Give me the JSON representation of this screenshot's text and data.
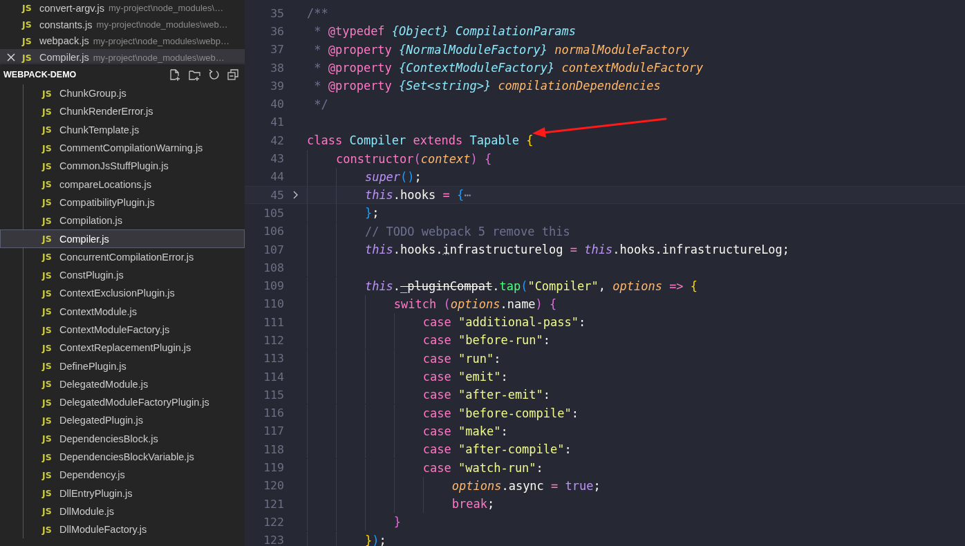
{
  "open_editors": [
    {
      "name": "convert-argv.js",
      "path": "my-project\\node_modules\\…",
      "icon": "JS",
      "selected": false
    },
    {
      "name": "constants.js",
      "path": "my-project\\node_modules\\web…",
      "icon": "JS",
      "selected": false
    },
    {
      "name": "webpack.js",
      "path": "my-project\\node_modules\\webp…",
      "icon": "JS",
      "selected": false
    },
    {
      "name": "Compiler.js",
      "path": "my-project\\node_modules\\web…",
      "icon": "JS",
      "selected": true
    }
  ],
  "explorer": {
    "title": "WEBPACK-DEMO",
    "actions": [
      {
        "kind": "new-file"
      },
      {
        "kind": "new-folder"
      },
      {
        "kind": "refresh"
      },
      {
        "kind": "collapse"
      }
    ],
    "files": [
      {
        "name": "ChunkGroup.js",
        "icon": "JS",
        "selected": false
      },
      {
        "name": "ChunkRenderError.js",
        "icon": "JS",
        "selected": false
      },
      {
        "name": "ChunkTemplate.js",
        "icon": "JS",
        "selected": false
      },
      {
        "name": "CommentCompilationWarning.js",
        "icon": "JS",
        "selected": false
      },
      {
        "name": "CommonJsStuffPlugin.js",
        "icon": "JS",
        "selected": false
      },
      {
        "name": "compareLocations.js",
        "icon": "JS",
        "selected": false
      },
      {
        "name": "CompatibilityPlugin.js",
        "icon": "JS",
        "selected": false
      },
      {
        "name": "Compilation.js",
        "icon": "JS",
        "selected": false
      },
      {
        "name": "Compiler.js",
        "icon": "JS",
        "selected": true
      },
      {
        "name": "ConcurrentCompilationError.js",
        "icon": "JS",
        "selected": false
      },
      {
        "name": "ConstPlugin.js",
        "icon": "JS",
        "selected": false
      },
      {
        "name": "ContextExclusionPlugin.js",
        "icon": "JS",
        "selected": false
      },
      {
        "name": "ContextModule.js",
        "icon": "JS",
        "selected": false
      },
      {
        "name": "ContextModuleFactory.js",
        "icon": "JS",
        "selected": false
      },
      {
        "name": "ContextReplacementPlugin.js",
        "icon": "JS",
        "selected": false
      },
      {
        "name": "DefinePlugin.js",
        "icon": "JS",
        "selected": false
      },
      {
        "name": "DelegatedModule.js",
        "icon": "JS",
        "selected": false
      },
      {
        "name": "DelegatedModuleFactoryPlugin.js",
        "icon": "JS",
        "selected": false
      },
      {
        "name": "DelegatedPlugin.js",
        "icon": "JS",
        "selected": false
      },
      {
        "name": "DependenciesBlock.js",
        "icon": "JS",
        "selected": false
      },
      {
        "name": "DependenciesBlockVariable.js",
        "icon": "JS",
        "selected": false
      },
      {
        "name": "Dependency.js",
        "icon": "JS",
        "selected": false
      },
      {
        "name": "DllEntryPlugin.js",
        "icon": "JS",
        "selected": false
      },
      {
        "name": "DllModule.js",
        "icon": "JS",
        "selected": false
      },
      {
        "name": "DllModuleFactory.js",
        "icon": "JS",
        "selected": false
      }
    ]
  },
  "editor": {
    "lines": [
      {
        "number": "35",
        "tokens": [
          {
            "text": "/**",
            "kind": "comment"
          }
        ]
      },
      {
        "number": "36",
        "tokens": [
          {
            "text": " *",
            "kind": "comment"
          },
          {
            "text": " @typedef",
            "kind": "tag"
          },
          {
            "text": " {Object}",
            "kind": "type"
          },
          {
            "text": " CompilationParams",
            "kind": "type"
          }
        ]
      },
      {
        "number": "37",
        "tokens": [
          {
            "text": " *",
            "kind": "comment"
          },
          {
            "text": " @property",
            "kind": "tag"
          },
          {
            "text": " {NormalModuleFactory}",
            "kind": "type"
          },
          {
            "text": " normalModuleFactory",
            "kind": "param"
          }
        ]
      },
      {
        "number": "38",
        "tokens": [
          {
            "text": " *",
            "kind": "comment"
          },
          {
            "text": " @property",
            "kind": "tag"
          },
          {
            "text": " {ContextModuleFactory}",
            "kind": "type"
          },
          {
            "text": " contextModuleFactory",
            "kind": "param"
          }
        ]
      },
      {
        "number": "39",
        "tokens": [
          {
            "text": " *",
            "kind": "comment"
          },
          {
            "text": " @property",
            "kind": "tag"
          },
          {
            "text": " {Set<string>}",
            "kind": "type"
          },
          {
            "text": " compilationDependencies",
            "kind": "param"
          }
        ]
      },
      {
        "number": "40",
        "tokens": [
          {
            "text": " */",
            "kind": "comment"
          }
        ]
      },
      {
        "number": "41"
      },
      {
        "number": "42",
        "tokens": [
          {
            "text": "class",
            "kind": "kw"
          },
          {
            "text": " Compiler",
            "kind": "cls"
          },
          {
            "text": " extends",
            "kind": "kw"
          },
          {
            "text": " Tapable",
            "kind": "cls"
          },
          {
            "text": " {",
            "kind": "b1"
          }
        ]
      },
      {
        "number": "43",
        "tokens": [
          {
            "text": "    constructor",
            "kind": "kw"
          },
          {
            "text": "(",
            "kind": "b2"
          },
          {
            "text": "context",
            "kind": "param"
          },
          {
            "text": ")",
            "kind": "b2"
          },
          {
            "text": " {",
            "kind": "b2"
          }
        ]
      },
      {
        "number": "44",
        "tokens": [
          {
            "text": "        super",
            "kind": "this"
          },
          {
            "text": "()",
            "kind": "b3"
          },
          {
            "text": ";",
            "kind": "plain"
          }
        ]
      },
      {
        "number": "45",
        "folded": true,
        "current": true,
        "tokens": [
          {
            "text": "        this",
            "kind": "this"
          },
          {
            "text": ".hooks",
            "kind": "plain"
          },
          {
            "text": " =",
            "kind": "kw"
          },
          {
            "text": " {",
            "kind": "b3"
          },
          {
            "text": "⋯",
            "kind": "fold"
          }
        ]
      },
      {
        "number": "105",
        "tokens": [
          {
            "text": "        }",
            "kind": "b3"
          },
          {
            "text": ";",
            "kind": "plain"
          }
        ]
      },
      {
        "number": "106",
        "tokens": [
          {
            "text": "        // TODO webpack 5 remove this",
            "kind": "comment"
          }
        ]
      },
      {
        "number": "107",
        "tokens": [
          {
            "text": "        this",
            "kind": "this"
          },
          {
            "text": ".hooks.",
            "kind": "plain"
          },
          {
            "text": "i",
            "kind": "hint"
          },
          {
            "text": "nfrastructurelog",
            "kind": "plain"
          },
          {
            "text": " =",
            "kind": "kw"
          },
          {
            "text": " this",
            "kind": "this"
          },
          {
            "text": ".hooks.infrastructureLog;",
            "kind": "plain"
          }
        ]
      },
      {
        "number": "108"
      },
      {
        "number": "109",
        "tokens": [
          {
            "text": "        this",
            "kind": "this"
          },
          {
            "text": ".",
            "kind": "plain"
          },
          {
            "text": "_pluginCompat",
            "kind": "deprecated"
          },
          {
            "text": ".",
            "kind": "plain"
          },
          {
            "text": "tap",
            "kind": "fn"
          },
          {
            "text": "(",
            "kind": "b3"
          },
          {
            "text": "\"Compiler\"",
            "kind": "str"
          },
          {
            "text": ",",
            "kind": "plain"
          },
          {
            "text": " options",
            "kind": "param"
          },
          {
            "text": " =>",
            "kind": "kw"
          },
          {
            "text": " {",
            "kind": "b1"
          }
        ]
      },
      {
        "number": "110",
        "tokens": [
          {
            "text": "            switch",
            "kind": "kw"
          },
          {
            "text": " (",
            "kind": "b2"
          },
          {
            "text": "options",
            "kind": "param"
          },
          {
            "text": ".name",
            "kind": "plain"
          },
          {
            "text": ")",
            "kind": "b2"
          },
          {
            "text": " {",
            "kind": "b2"
          }
        ]
      },
      {
        "number": "111",
        "tokens": [
          {
            "text": "                case",
            "kind": "kw"
          },
          {
            "text": " \"additional-pass\"",
            "kind": "str"
          },
          {
            "text": ":",
            "kind": "plain"
          }
        ]
      },
      {
        "number": "112",
        "tokens": [
          {
            "text": "                case",
            "kind": "kw"
          },
          {
            "text": " \"before-run\"",
            "kind": "str"
          },
          {
            "text": ":",
            "kind": "plain"
          }
        ]
      },
      {
        "number": "113",
        "tokens": [
          {
            "text": "                case",
            "kind": "kw"
          },
          {
            "text": " \"run\"",
            "kind": "str"
          },
          {
            "text": ":",
            "kind": "plain"
          }
        ]
      },
      {
        "number": "114",
        "tokens": [
          {
            "text": "                case",
            "kind": "kw"
          },
          {
            "text": " \"emit\"",
            "kind": "str"
          },
          {
            "text": ":",
            "kind": "plain"
          }
        ]
      },
      {
        "number": "115",
        "tokens": [
          {
            "text": "                case",
            "kind": "kw"
          },
          {
            "text": " \"after-emit\"",
            "kind": "str"
          },
          {
            "text": ":",
            "kind": "plain"
          }
        ]
      },
      {
        "number": "116",
        "tokens": [
          {
            "text": "                case",
            "kind": "kw"
          },
          {
            "text": " \"before-compile\"",
            "kind": "str"
          },
          {
            "text": ":",
            "kind": "plain"
          }
        ]
      },
      {
        "number": "117",
        "tokens": [
          {
            "text": "                case",
            "kind": "kw"
          },
          {
            "text": " \"make\"",
            "kind": "str"
          },
          {
            "text": ":",
            "kind": "plain"
          }
        ]
      },
      {
        "number": "118",
        "tokens": [
          {
            "text": "                case",
            "kind": "kw"
          },
          {
            "text": " \"after-compile\"",
            "kind": "str"
          },
          {
            "text": ":",
            "kind": "plain"
          }
        ]
      },
      {
        "number": "119",
        "tokens": [
          {
            "text": "                case",
            "kind": "kw"
          },
          {
            "text": " \"watch-run\"",
            "kind": "str"
          },
          {
            "text": ":",
            "kind": "plain"
          }
        ]
      },
      {
        "number": "120",
        "tokens": [
          {
            "text": "                    options",
            "kind": "param"
          },
          {
            "text": ".async",
            "kind": "plain"
          },
          {
            "text": " =",
            "kind": "kw"
          },
          {
            "text": " true",
            "kind": "const"
          },
          {
            "text": ";",
            "kind": "plain"
          }
        ]
      },
      {
        "number": "121",
        "tokens": [
          {
            "text": "                    break",
            "kind": "kw"
          },
          {
            "text": ";",
            "kind": "plain"
          }
        ]
      },
      {
        "number": "122",
        "tokens": [
          {
            "text": "            }",
            "kind": "b2"
          }
        ]
      },
      {
        "number": "123",
        "tokens": [
          {
            "text": "        }",
            "kind": "b1"
          },
          {
            "text": ")",
            "kind": "b3"
          },
          {
            "text": ";",
            "kind": "plain"
          }
        ]
      }
    ],
    "annotations": [
      {
        "kind": "arrow"
      }
    ]
  }
}
